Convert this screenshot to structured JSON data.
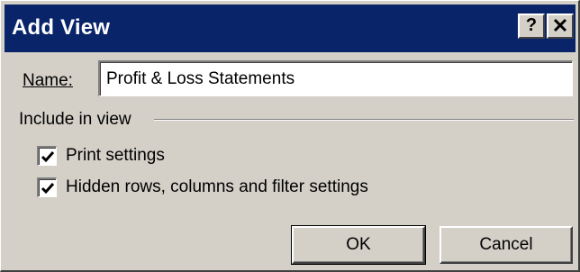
{
  "window": {
    "title": "Add View",
    "help_label": "?",
    "close_label": "X"
  },
  "name_field": {
    "label": "Name:",
    "value": "Profit & Loss Statements"
  },
  "include_group": {
    "label": "Include in view",
    "options": [
      {
        "label": "Print settings",
        "checked": true
      },
      {
        "label": "Hidden rows, columns and filter settings",
        "checked": true
      }
    ]
  },
  "buttons": {
    "ok_label": "OK",
    "cancel_label": "Cancel"
  }
}
